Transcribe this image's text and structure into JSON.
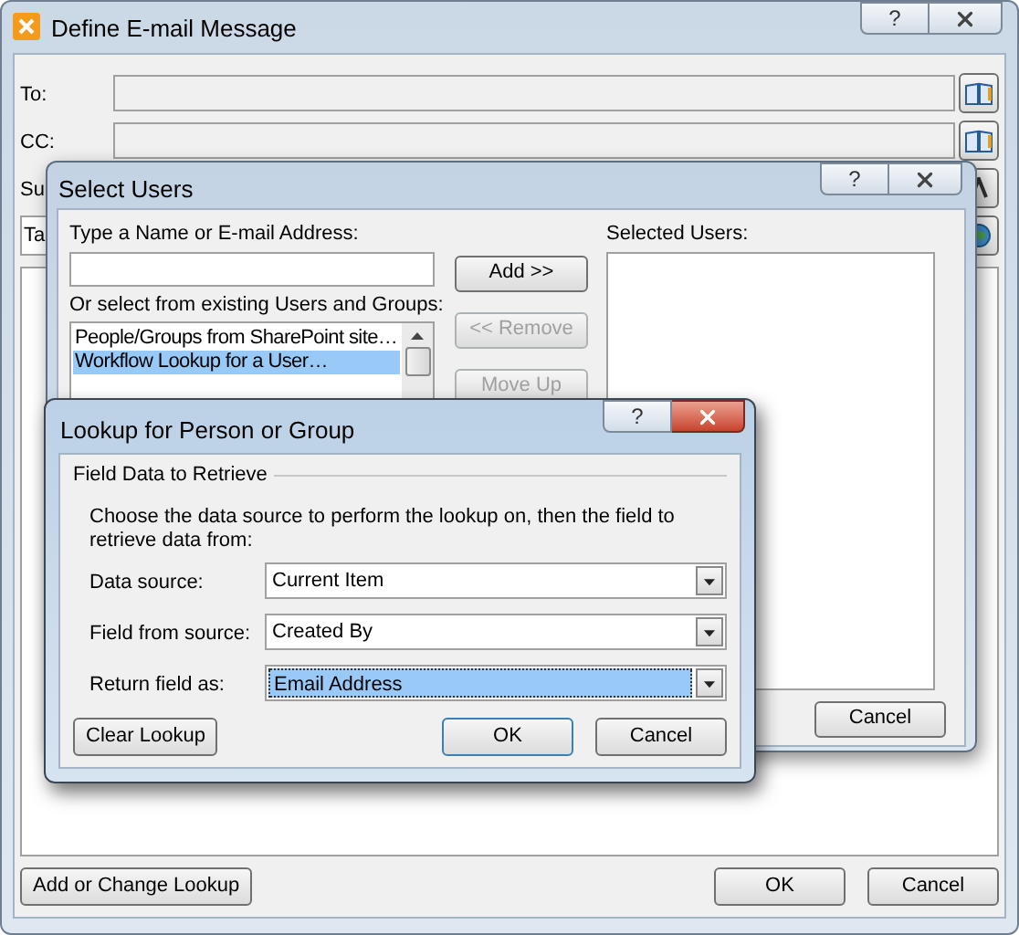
{
  "main_window": {
    "title": "Define E-mail Message",
    "help": "?",
    "rows": [
      {
        "kind": "labeled",
        "label": "To:"
      },
      {
        "kind": "labeled",
        "label": "CC:"
      },
      {
        "kind": "labeled",
        "label": "Su"
      },
      {
        "kind": "input",
        "value": "Ta"
      }
    ],
    "buttons": [
      "Add or Change Lookup",
      "OK",
      "Cancel"
    ]
  },
  "select_users": {
    "title": "Select Users",
    "help": "?",
    "name_label": "Type a Name or E-mail Address:",
    "existing_label": "Or select from existing Users and Groups:",
    "list_items": [
      {
        "text": "People/Groups from SharePoint site…",
        "selected": false
      },
      {
        "text": "Workflow Lookup for a User…",
        "selected": true
      }
    ],
    "side_buttons": [
      {
        "label": "Add >>",
        "disabled": false
      },
      {
        "label": "<< Remove",
        "disabled": true
      },
      {
        "label": "Move Up",
        "disabled": true
      }
    ],
    "selected_label": "Selected Users:",
    "buttons": [
      "Cancel"
    ]
  },
  "lookup": {
    "title": "Lookup for Person or Group",
    "help": "?",
    "group_label": "Field Data to Retrieve",
    "description": "Choose the data source to perform the lookup on, then the field to retrieve data from:",
    "rows": [
      {
        "label": "Data source:",
        "value": "Current Item",
        "selected": false
      },
      {
        "label": "Field from source:",
        "value": "Created By",
        "selected": false
      },
      {
        "label": "Return field as:",
        "value": "Email Address",
        "selected": true
      }
    ],
    "buttons": [
      {
        "label": "Clear Lookup",
        "default": false
      },
      {
        "label": "OK",
        "default": true
      },
      {
        "label": "Cancel",
        "default": false
      }
    ]
  }
}
